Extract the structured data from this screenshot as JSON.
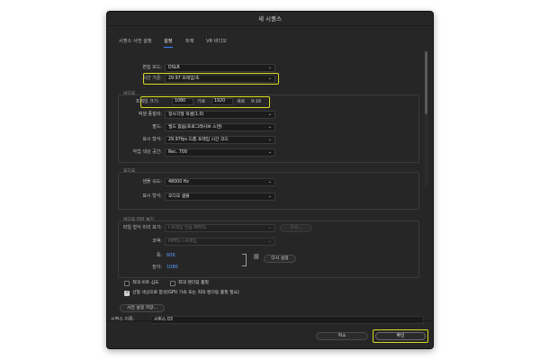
{
  "dialog": {
    "title": "새 시퀀스"
  },
  "tabs": [
    {
      "label": "시퀀스 사전 설정"
    },
    {
      "label": "설정"
    },
    {
      "label": "트랙"
    },
    {
      "label": "VR 비디오"
    }
  ],
  "settings": {
    "editing_mode_label": "편집 모드:",
    "editing_mode_value": "DSLR",
    "timebase_label": "시간 기준:",
    "timebase_value": "29.97 프레임/초"
  },
  "video": {
    "section": "비디오",
    "frame_size_label": "프레임 크기:",
    "width_value": "1080",
    "width_label": "가로",
    "height_value": "1920",
    "height_label": "세로",
    "ratio": "9:16",
    "pixel_aspect_label": "픽셀 종횡비:",
    "pixel_aspect_value": "정사각형 픽셀(1.0)",
    "fields_label": "필드:",
    "fields_value": "필드 없음(프로그레시브 스캔)",
    "display_format_label": "표시 형식:",
    "display_format_value": "29.97fps 드롭 프레임 시간 코드",
    "color_space_label": "작업 색상 공간:",
    "color_space_value": "Rec. 709"
  },
  "audio": {
    "section": "오디오",
    "sample_rate_label": "샘플 속도:",
    "sample_rate_value": "48000 Hz",
    "display_format_label": "표시 형식:",
    "display_format_value": "오디오 샘플"
  },
  "preview": {
    "section": "비디오 미리 보기",
    "file_format_label": "파일 형식 미리 보기:",
    "file_format_value": "I-프레임 전용 MPEG",
    "configure_button": "구성...",
    "codec_label": "코덱:",
    "codec_value": "MPEG I-프레임",
    "width_label": "폭:",
    "width_value": "608",
    "height_label": "높이:",
    "height_value": "1080",
    "reset_button": "다시 설정"
  },
  "options": {
    "max_bit_depth": "최대 비트 심도",
    "max_render_quality": "최대 렌더링 품질",
    "linear_color": "선형 색상으로 합성(GPU 가속 또는 최대 렌더링 품질 필요)"
  },
  "buttons": {
    "save_preset": "사전 설정 저장...",
    "cancel": "취소",
    "ok": "확인"
  },
  "sequence_name": {
    "label": "시퀀스 이름:",
    "value": "시퀀스 03"
  }
}
